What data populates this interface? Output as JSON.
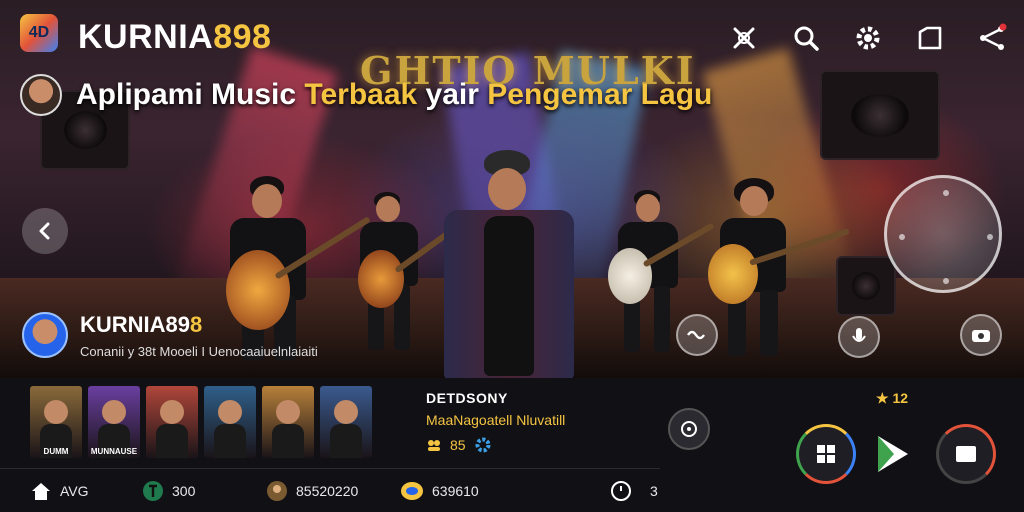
{
  "header": {
    "logo_text": "4D",
    "brand_name": "KURNIA",
    "brand_number": "898",
    "icons": [
      "close-icon",
      "search-icon",
      "gear-icon",
      "folder-icon",
      "share-icon"
    ]
  },
  "tagline": {
    "part1": "Aplipami Music ",
    "part2": "Terbaak",
    "part3": " yair ",
    "part4": "Pengemar Lagu"
  },
  "stage": {
    "sign_text": "GHTIO MULKI"
  },
  "artist": {
    "name": "KURNIA89",
    "name_suffix": "8",
    "subtitle": "Conanii y 38t Mooeli I Uenocaaiuelnlaiaiti"
  },
  "track": {
    "title": "DETDSONY",
    "subtitle": "MaaNagoatell Nluvatill",
    "count": "85",
    "rating": "12"
  },
  "thumbnails": [
    {
      "caption": "DUMM",
      "bg": "#8a6a3a"
    },
    {
      "caption": "MUNNAUSE",
      "bg": "#6a3fa0"
    },
    {
      "caption": "",
      "bg": "#b0463a"
    },
    {
      "caption": "",
      "bg": "#2f5f8a"
    },
    {
      "caption": "",
      "bg": "#b7803a"
    },
    {
      "caption": "",
      "bg": "#3a5a8f"
    }
  ],
  "nav": [
    {
      "label": "AVG",
      "icon": "home-icon"
    },
    {
      "label": "300",
      "icon": "music-icon"
    },
    {
      "label": "85520220",
      "icon": "user-icon"
    },
    {
      "label": "639610",
      "icon": "coin-icon"
    },
    {
      "label": "3",
      "icon": "timer-icon"
    }
  ],
  "colors": {
    "accent": "#f5c542",
    "panel": "#111015",
    "play": "#3fa34d"
  }
}
